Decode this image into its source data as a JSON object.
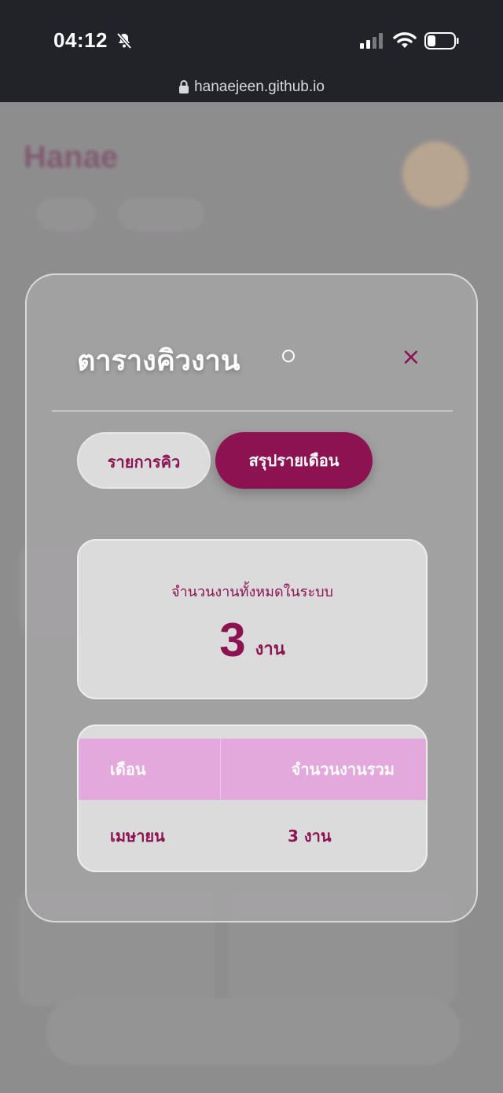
{
  "status_bar": {
    "time": "04:12",
    "url": "hanaejeen.github.io"
  },
  "background": {
    "brand": "Hanae"
  },
  "modal": {
    "title": "ตารางคิวงาน",
    "close_label": "×",
    "tabs": [
      {
        "label": "รายการคิว",
        "active": false
      },
      {
        "label": "สรุปรายเดือน",
        "active": true
      }
    ],
    "summary": {
      "label": "จำนวนงานทั้งหมดในระบบ",
      "value": "3",
      "unit": "งาน"
    },
    "table": {
      "headers": [
        "เดือน",
        "จำนวนงานรวม"
      ],
      "rows": [
        [
          "เมษายน",
          "3 งาน"
        ]
      ]
    }
  },
  "colors": {
    "accent": "#8c1251",
    "header_pink": "#e3a8dc",
    "status_bar": "#222328"
  },
  "icons": [
    "bell-slash-icon",
    "signal-icon",
    "wifi-icon",
    "battery-icon",
    "lock-icon",
    "close-icon"
  ]
}
